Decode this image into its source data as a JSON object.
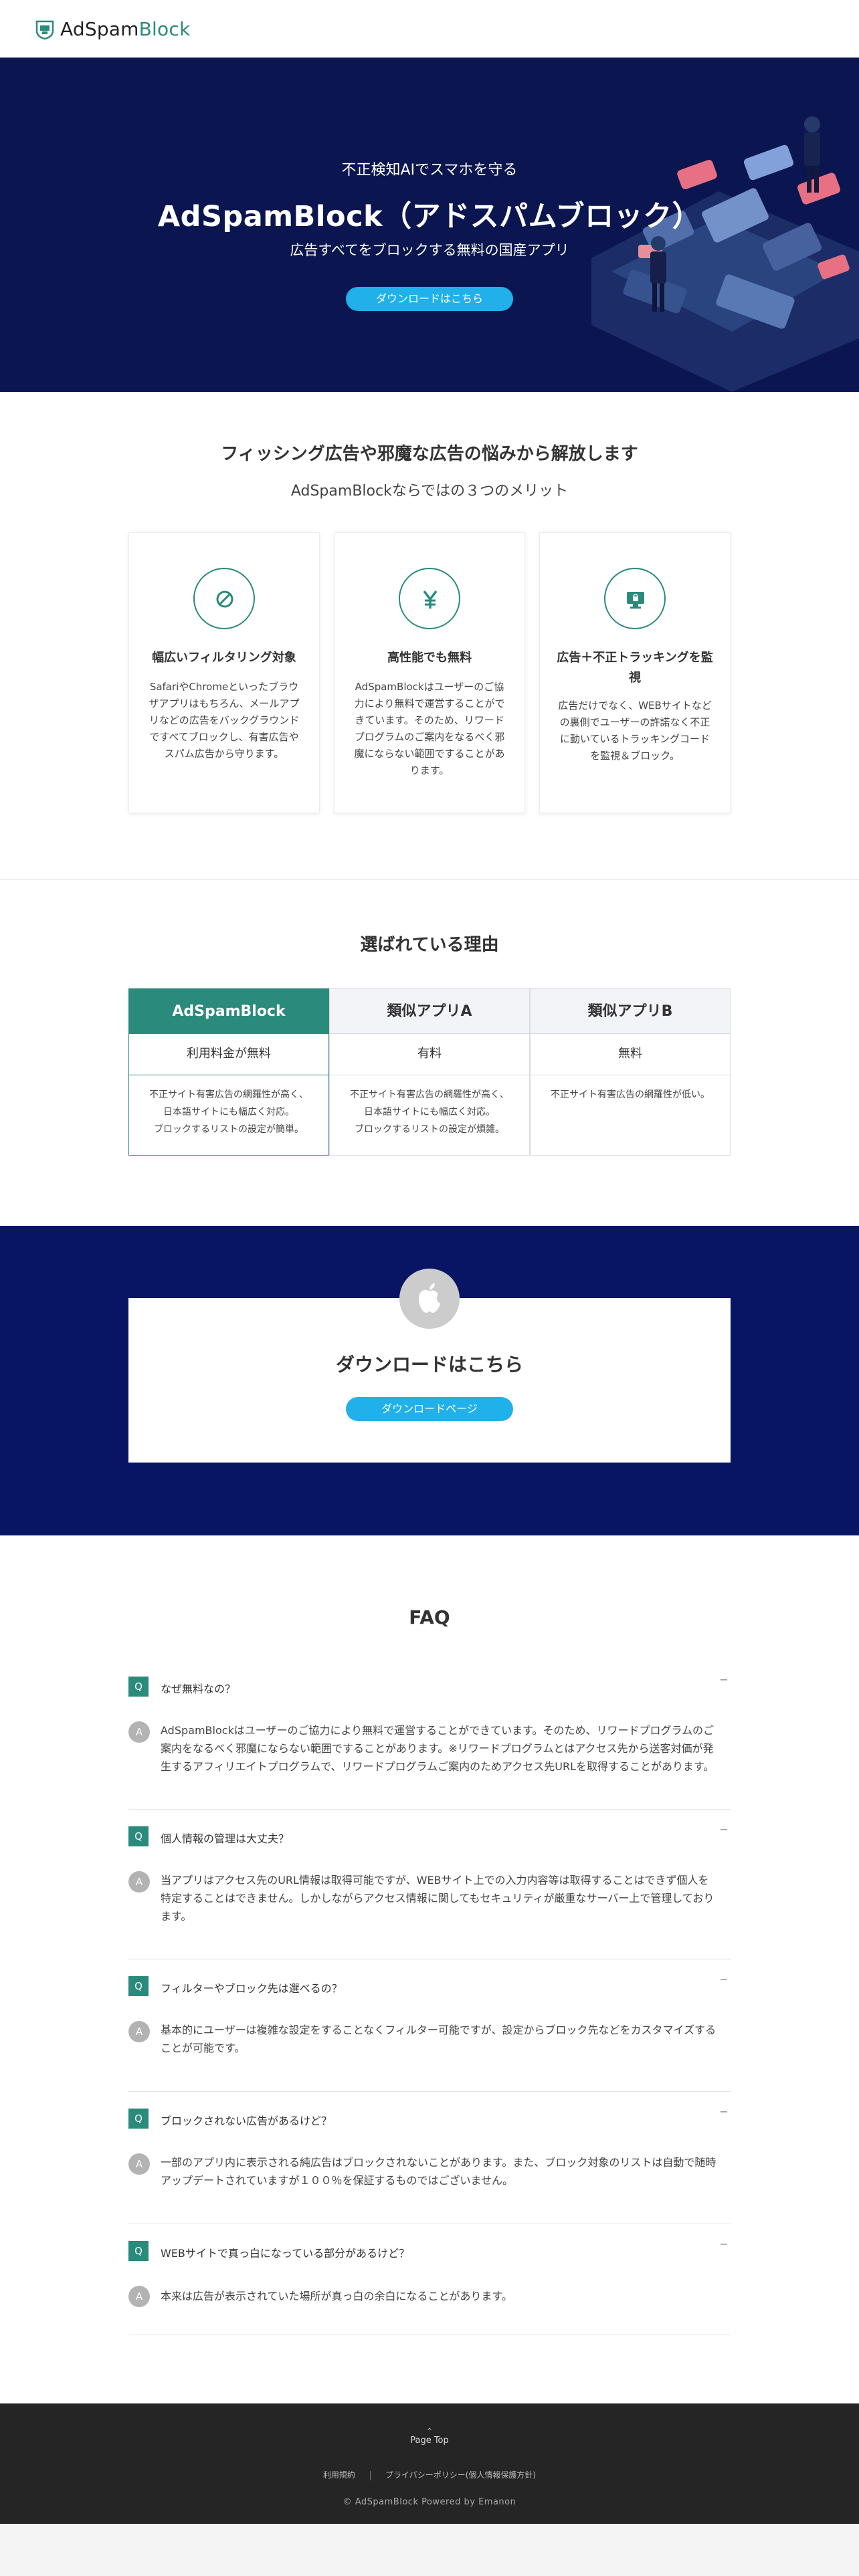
{
  "header": {
    "logo_ad": "Ad",
    "logo_spam": "Spam",
    "logo_block": "Block"
  },
  "hero": {
    "subtitle": "不正検知AIでスマホを守る",
    "title": "AdSpamBlock（アドスパムブロック）",
    "tagline": "広告すべてをブロックする無料の国産アプリ",
    "button": "ダウンロードはこちら"
  },
  "merits": {
    "title": "フィッシング広告や邪魔な広告の悩みから解放します",
    "subtitle": "AdSpamBlockならではの３つのメリット",
    "cards": [
      {
        "icon": "block-icon",
        "title": "幅広いフィルタリング対象",
        "lines": [
          "SafariやChromeといったブラウ",
          "ザアプリはもちろん、メールアプ",
          "リなどの広告をバックグラウンド",
          "ですべてブロックし、有害広告や",
          "スパム広告から守ります。"
        ]
      },
      {
        "icon": "yen-icon",
        "title": "高性能でも無料",
        "lines": [
          "AdSpamBlockはユーザーのご協",
          "力により無料で運営することがで",
          "きています。そのため、リワード",
          "プログラムのご案内をなるべく邪",
          "魔にならない範囲ですることがあ",
          "ります。"
        ]
      },
      {
        "icon": "monitor-lock-icon",
        "title": "広告＋不正トラッキングを監視",
        "title_lines": [
          "広告＋不正トラッキングを監",
          "視"
        ],
        "lines": [
          "広告だけでなく、WEBサイトなど",
          "の裏側でユーザーの許諾なく不正",
          "に動いているトラッキングコード",
          "を監視＆ブロック。"
        ]
      }
    ]
  },
  "reasons": {
    "title": "選ばれている理由",
    "columns": [
      {
        "name": "AdSpamBlock",
        "price": "利用料金が無料",
        "lines": [
          "不正サイト有害広告の網羅性が高く、",
          "日本語サイトにも幅広く対応。",
          "ブロックするリストの設定が簡単。"
        ]
      },
      {
        "name": "類似アプリA",
        "price": "有料",
        "lines": [
          "不正サイト有害広告の網羅性が高く、",
          "日本語サイトにも幅広く対応。",
          "ブロックするリストの設定が煩雑。"
        ]
      },
      {
        "name": "類似アプリB",
        "price": "無料",
        "lines": [
          "不正サイト有害広告の網羅性が低い。"
        ]
      }
    ]
  },
  "download": {
    "icon": "apple-icon",
    "title": "ダウンロードはこちら",
    "button": "ダウンロードページ"
  },
  "faq": {
    "title": "FAQ",
    "q_badge": "Q",
    "a_badge": "A",
    "toggle": "−",
    "items": [
      {
        "q": "なぜ無料なの？",
        "a_lines": [
          "AdSpamBlockはユーザーのご協力により無料で運営することができています。そのため、リワードプログラムのご",
          "案内をなるべく邪魔にならない範囲ですることがあります。※リワードプログラムとはアクセス先から送客対価が発",
          "生するアフィリエイトプログラムで、リワードプログラムご案内のためアクセス先URLを取得することがあります。"
        ]
      },
      {
        "q": "個人情報の管理は大丈夫？",
        "a_lines": [
          "当アプリはアクセス先のURL情報は取得可能ですが、WEBサイト上での入力内容等は取得することはできず個人を",
          "特定することはできません。しかしながらアクセス情報に関してもセキュリティが厳重なサーバー上で管理しており",
          "ます。"
        ]
      },
      {
        "q": "フィルターやブロック先は選べるの？",
        "a_lines": [
          "基本的にユーザーは複雑な設定をすることなくフィルター可能ですが、設定からブロック先などをカスタマイズする",
          "ことが可能です。"
        ]
      },
      {
        "q": "ブロックされない広告があるけど？",
        "a_lines": [
          "一部のアプリ内に表示される純広告はブロックされないことがあります。また、ブロック対象のリストは自動で随時",
          "アップデートされていますが１００％を保証するものではございません。"
        ]
      },
      {
        "q": "WEBサイトで真っ白になっている部分があるけど？",
        "a_lines": [
          "本来は広告が表示されていた場所が真っ白の余白になることがあります。"
        ]
      }
    ]
  },
  "footer": {
    "pagetop_arrow": "^",
    "pagetop": "Page Top",
    "links": [
      "利用規約",
      "プライバシーポリシー(個人情報保護方針)"
    ],
    "copyright": "© AdSpamBlock Powered by Emanon"
  },
  "colors": {
    "brand_green": "#2a8a7c",
    "navy": "#0b1650",
    "button_blue": "#21b1ea",
    "footer": "#252525"
  }
}
